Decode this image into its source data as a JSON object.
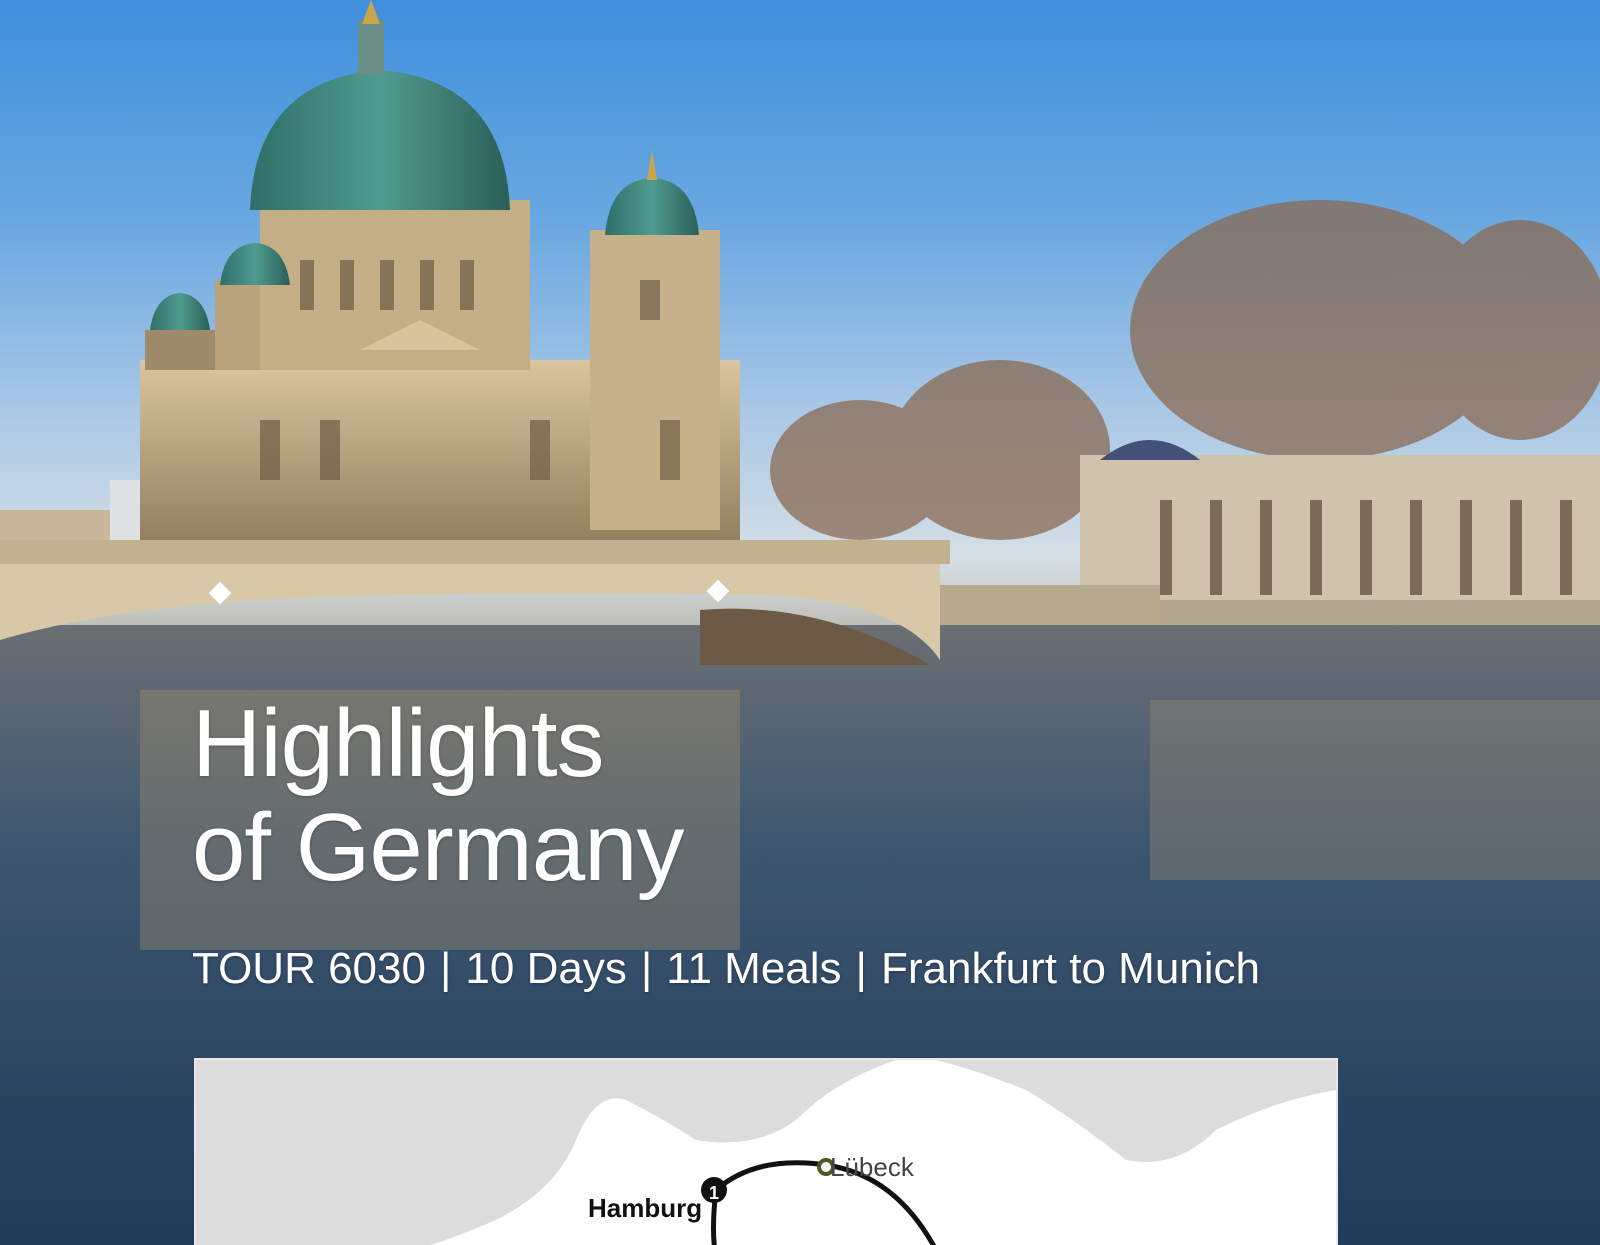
{
  "hero": {
    "title_line1": "Highlights",
    "title_line2": "of Germany"
  },
  "tour_info": {
    "tour": "TOUR 6030",
    "days": "10 Days",
    "meals": "11 Meals",
    "route": "Frankfurt to Munich",
    "separator": "|"
  },
  "map": {
    "cities": [
      {
        "name": "Lübeck"
      },
      {
        "name": "Hamburg",
        "stop_number": "1"
      }
    ],
    "colors": {
      "land": "#ffffff",
      "sea": "#dcdcdc",
      "route": "#111111"
    }
  }
}
